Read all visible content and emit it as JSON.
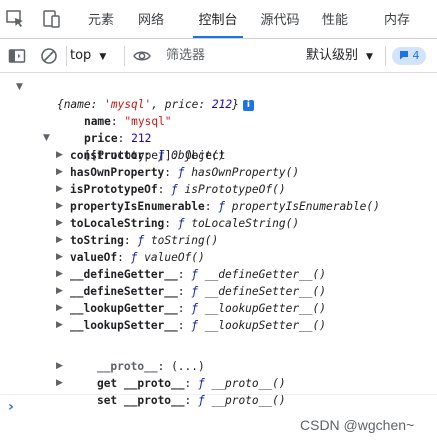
{
  "tabs": [
    {
      "label": "元素"
    },
    {
      "label": "网络"
    },
    {
      "label": "控制台"
    },
    {
      "label": "源代码"
    },
    {
      "label": "性能"
    },
    {
      "label": "内存"
    }
  ],
  "active_tab": "控制台",
  "toolbar": {
    "context": "top",
    "filter_placeholder": "筛选器",
    "levels": "默认级别",
    "message_count": "4"
  },
  "console": {
    "summary_open": "{name: ",
    "summary_name": "'mysql'",
    "summary_mid": ", price: ",
    "summary_price": "212",
    "summary_close": "}",
    "info_icon": "i",
    "props": [
      {
        "key": "name",
        "value": "\"mysql\""
      },
      {
        "key": "price",
        "value": "212"
      }
    ],
    "prototype_key": "[[Prototype]]",
    "prototype_value": "Object",
    "proto_items": [
      {
        "key": "constructor",
        "fn": "Object()"
      },
      {
        "key": "hasOwnProperty",
        "fn": "hasOwnProperty()"
      },
      {
        "key": "isPrototypeOf",
        "fn": "isPrototypeOf()"
      },
      {
        "key": "propertyIsEnumerable",
        "fn": "propertyIsEnumerable()"
      },
      {
        "key": "toLocaleString",
        "fn": "toLocaleString()"
      },
      {
        "key": "toString",
        "fn": "toString()"
      },
      {
        "key": "valueOf",
        "fn": "valueOf()"
      },
      {
        "key": "__defineGetter__",
        "fn": "__defineGetter__()"
      },
      {
        "key": "__defineSetter__",
        "fn": "__defineSetter__()"
      },
      {
        "key": "__lookupGetter__",
        "fn": "__lookupGetter__()"
      },
      {
        "key": "__lookupSetter__",
        "fn": "__lookupSetter__()"
      }
    ],
    "proto_accessor_key": "__proto__",
    "proto_accessor_value": "(...)",
    "getter": {
      "label": "get __proto__",
      "fn": "__proto__()"
    },
    "setter": {
      "label": "set __proto__",
      "fn": "__proto__()"
    },
    "f_symbol": "ƒ"
  },
  "prompt_symbol": "›",
  "watermark": "CSDN @wgchen~",
  "colors": {
    "accent": "#1a73e8",
    "string": "#c41a16",
    "number": "#1c00cf"
  }
}
